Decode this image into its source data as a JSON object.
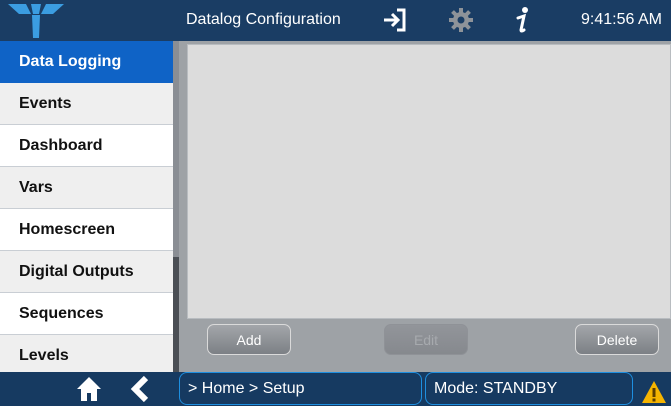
{
  "header": {
    "title": "Datalog Configuration",
    "time": "9:41:56 AM",
    "icons": [
      "teledyne-logo-icon",
      "exit-icon",
      "gear-icon",
      "info-icon"
    ]
  },
  "sidebar": {
    "items": [
      {
        "label": "Data Logging",
        "active": true
      },
      {
        "label": "Events"
      },
      {
        "label": "Dashboard"
      },
      {
        "label": "Vars"
      },
      {
        "label": "Homescreen"
      },
      {
        "label": "Digital Outputs"
      },
      {
        "label": "Sequences"
      },
      {
        "label": "Levels"
      }
    ]
  },
  "main": {
    "buttons": {
      "add": "Add",
      "edit": "Edit",
      "delete": "Delete"
    }
  },
  "footer": {
    "breadcrumb": "> Home > Setup",
    "mode": "Mode: STANDBY",
    "icons": [
      "home-icon",
      "back-icon",
      "warning-icon"
    ]
  },
  "colors": {
    "header_bg": "#1a3d64",
    "active_item": "#0f63c6",
    "panel_bg": "#dcdcdc",
    "accent_border": "#1e8fe0",
    "warning": "#f5b400"
  }
}
